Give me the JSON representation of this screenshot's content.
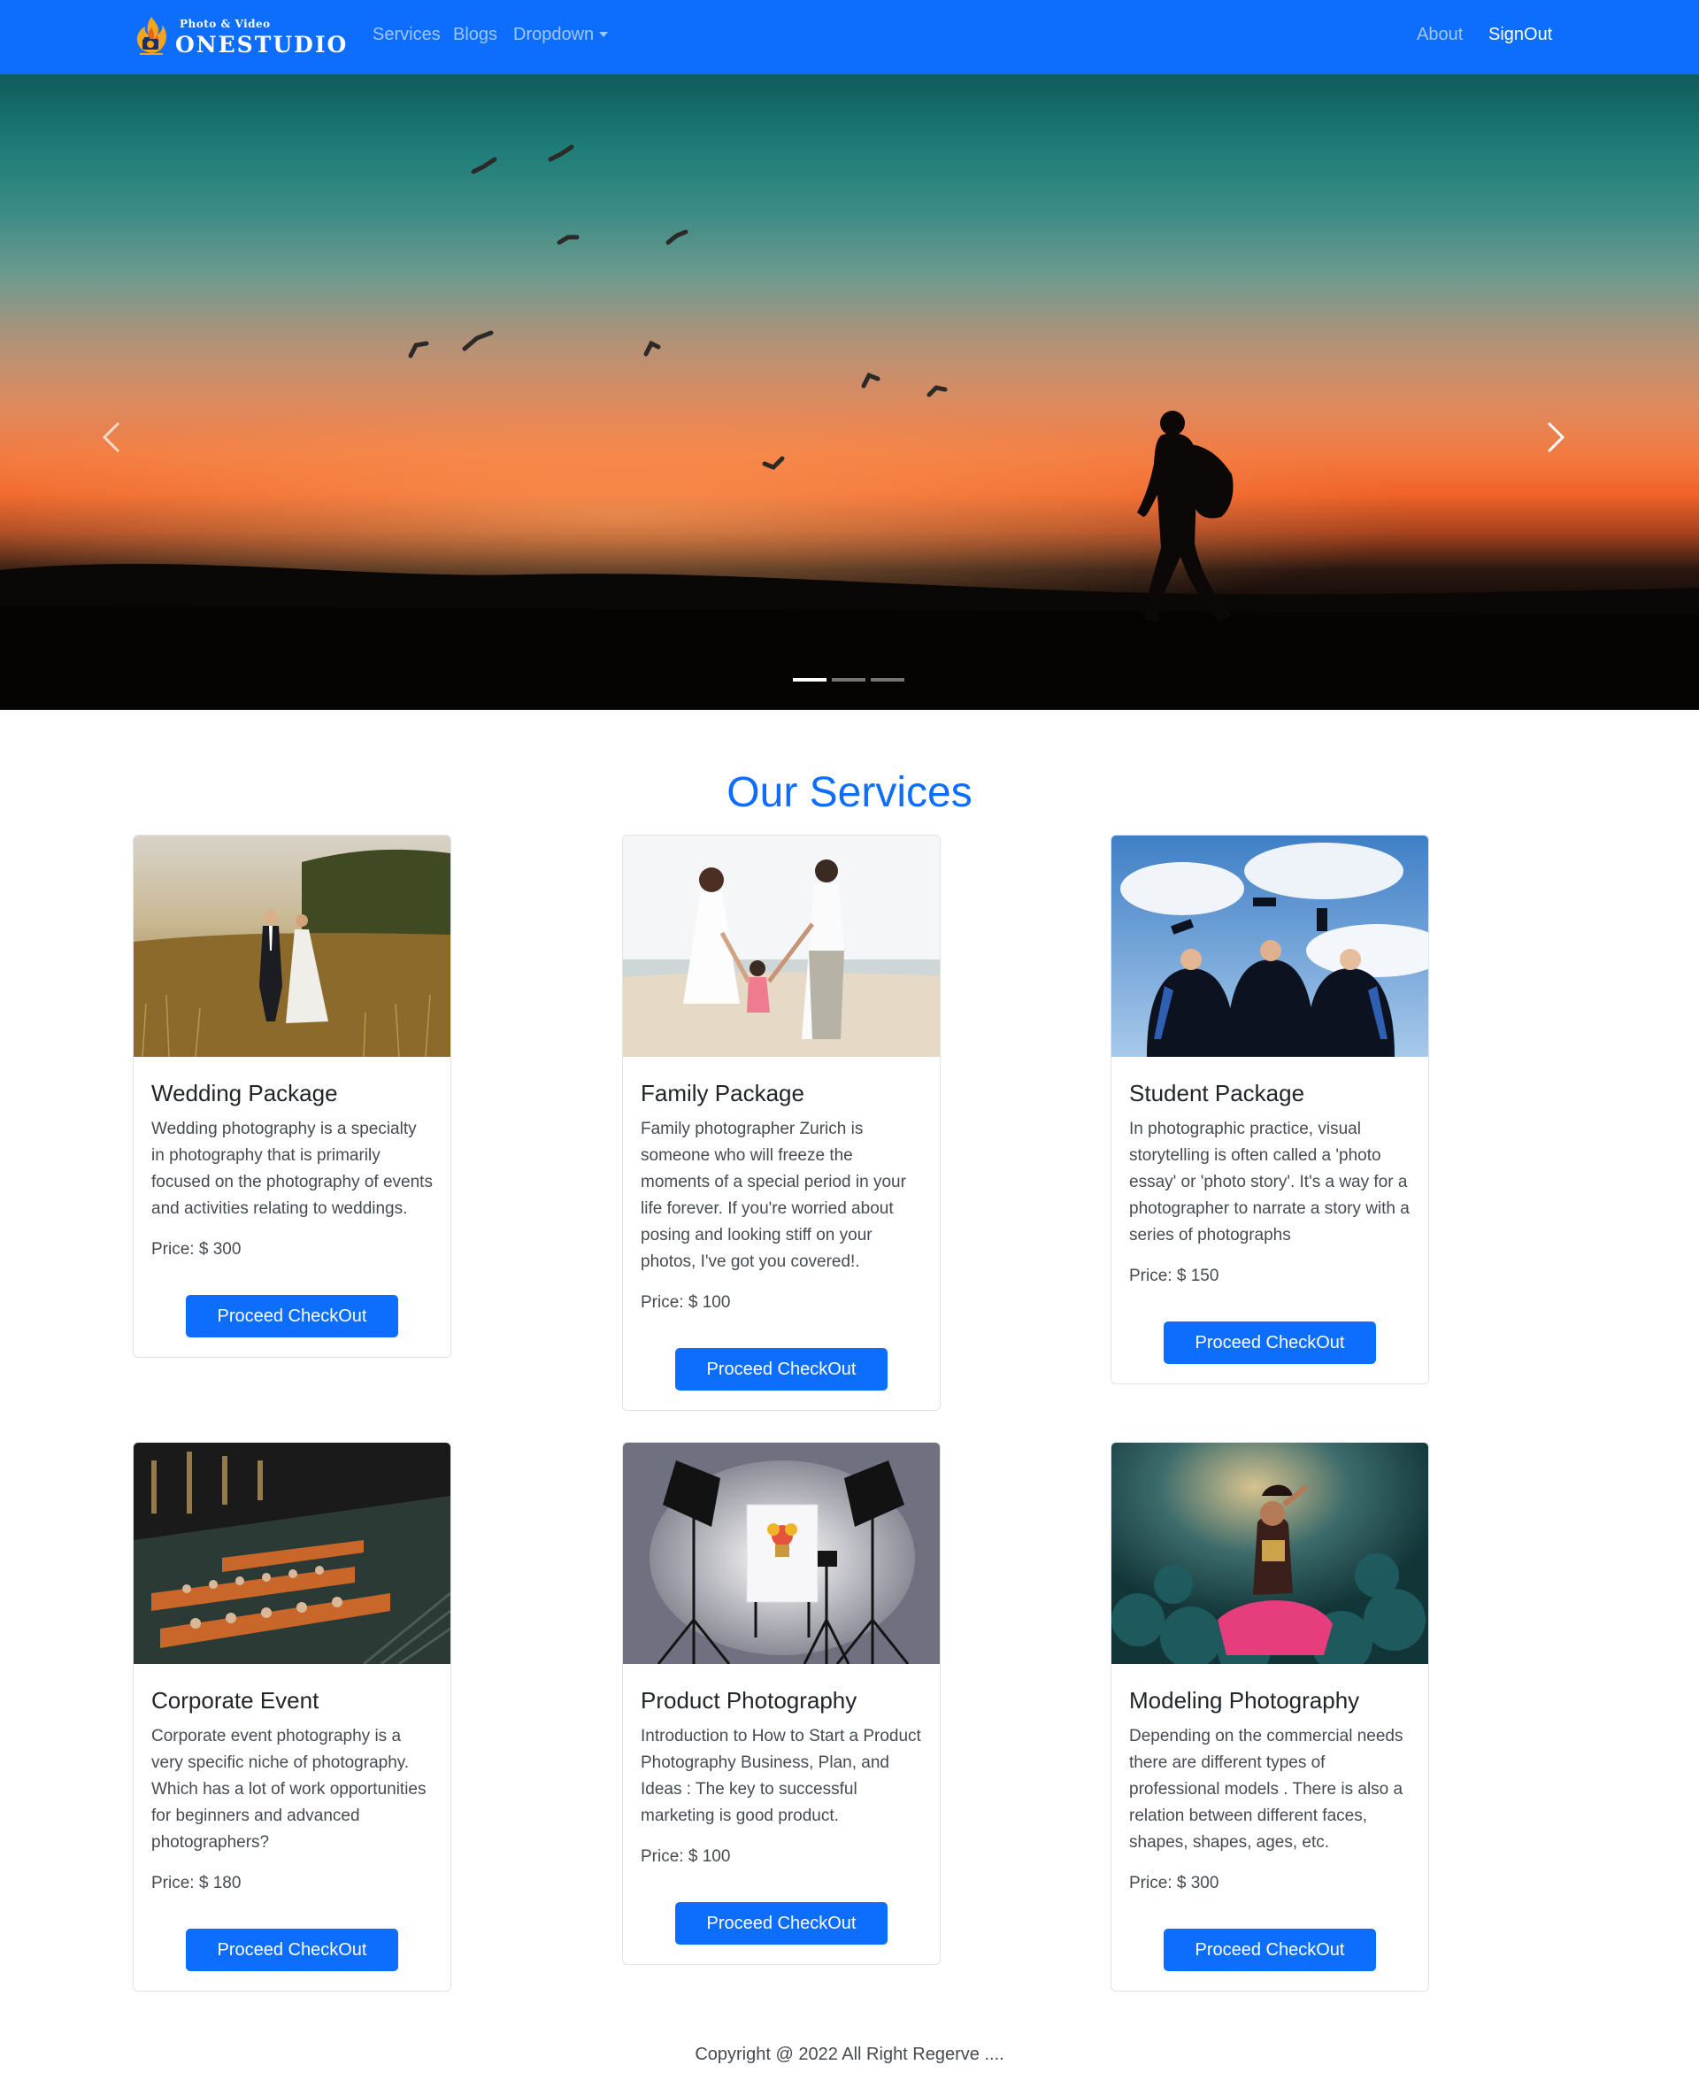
{
  "brand": {
    "tagline": "Photo & Video",
    "name": "ONESTUDIO"
  },
  "nav": {
    "services": "Services",
    "blogs": "Blogs",
    "dropdown": "Dropdown",
    "about": "About",
    "signout": "SignOut"
  },
  "carousel": {
    "slide_count": 3,
    "active_slide": 1
  },
  "services": {
    "title": "Our Services",
    "items": [
      {
        "title": "Wedding Package",
        "text": "Wedding photography is a specialty in photography that is primarily focused on the photography of events and activities relating to weddings.",
        "price": "Price: $ 300",
        "button": "Proceed CheckOut"
      },
      {
        "title": "Family Package",
        "text": "Family photographer Zurich is someone who will freeze the moments of a special period in your life forever. If you're worried about posing and looking stiff on your photos, I've got you covered!.",
        "price": "Price: $ 100",
        "button": "Proceed CheckOut"
      },
      {
        "title": "Student Package",
        "text": "In photographic practice, visual storytelling is often called a 'photo essay' or 'photo story'. It's a way for a photographer to narrate a story with a series of photographs",
        "price": "Price: $ 150",
        "button": "Proceed CheckOut"
      },
      {
        "title": "Corporate Event",
        "text": "Corporate event photography is a very specific niche of photography. Which has a lot of work opportunities for beginners and advanced photographers?",
        "price": "Price: $ 180",
        "button": "Proceed CheckOut"
      },
      {
        "title": "Product Photography",
        "text": "Introduction to How to Start a Product Photography Business, Plan, and Ideas : The key to successful marketing is good product.",
        "price": "Price: $ 100",
        "button": "Proceed CheckOut"
      },
      {
        "title": "Modeling Photography",
        "text": "Depending on the commercial needs there are different types of professional models . There is also a relation between different faces, shapes, shapes, ages, etc.",
        "price": "Price: $ 300",
        "button": "Proceed CheckOut"
      }
    ]
  },
  "footer": {
    "text": "Copyright @ 2022 All Right Regerve ...."
  },
  "colors": {
    "primary": "#0d6efd",
    "text": "#212529",
    "muted": "#454b52"
  }
}
